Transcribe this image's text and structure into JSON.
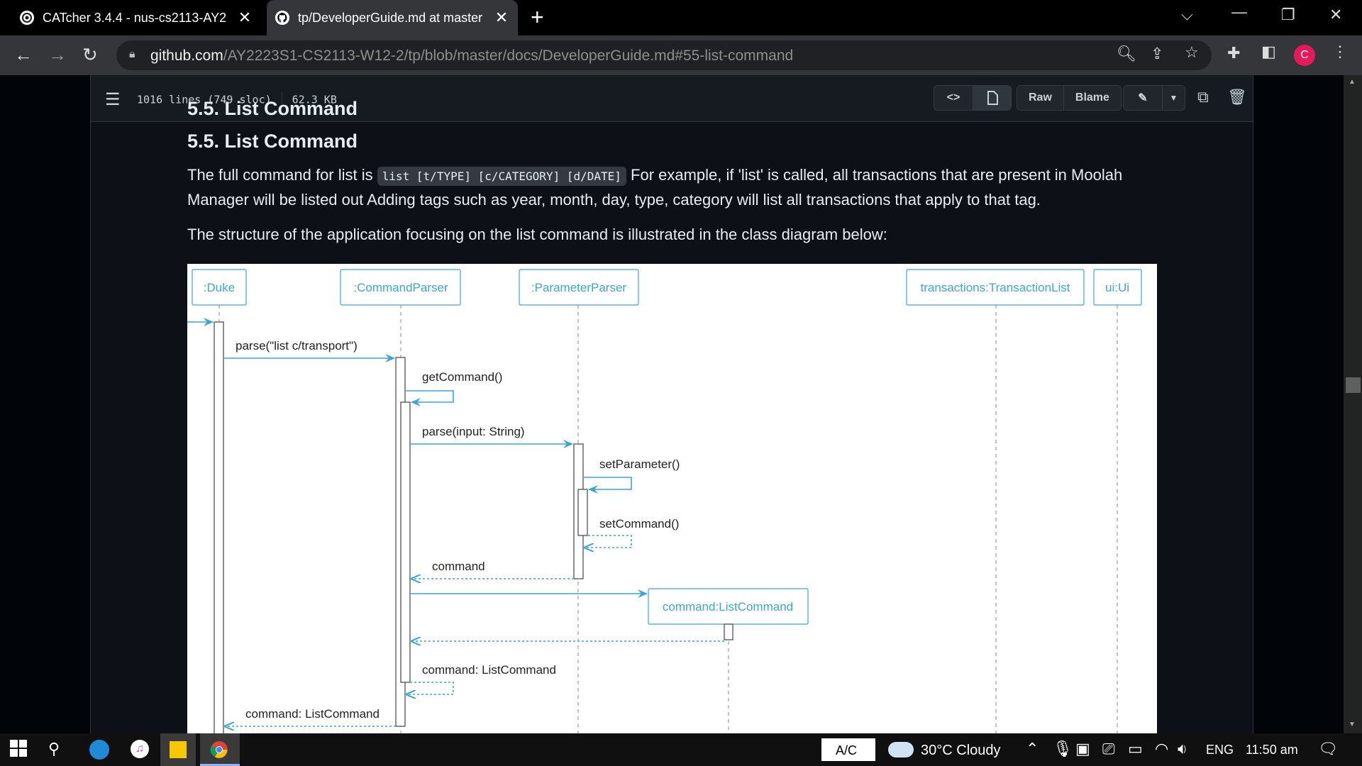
{
  "browser": {
    "tabs": [
      {
        "title": "CATcher 3.4.4 - nus-cs2113-AY22",
        "icon": "catcher-icon"
      },
      {
        "title": "tp/DeveloperGuide.md at master",
        "icon": "github-icon"
      }
    ],
    "url_host": "github.com",
    "url_path": "/AY2223S1-CS2113-W12-2/tp/blob/master/docs/DeveloperGuide.md#55-list-command",
    "profile_initial": "C"
  },
  "file_header": {
    "lines": "1016 lines (749 sloc)",
    "size": "62.3 KB",
    "raw_label": "Raw",
    "blame_label": "Blame"
  },
  "content": {
    "heading": "5.5. List Command",
    "p1_before": "The full command for list is ",
    "p1_code": "list [t/TYPE] [c/CATEGORY] [d/DATE]",
    "p1_after": " For example, if 'list' is called, all transactions that are present in Moolah Manager will be listed out Adding tags such as year, month, day, type, category will list all transactions that apply to that tag.",
    "p2": "The structure of the application focusing on the list command is illustrated in the class diagram below:"
  },
  "diagram": {
    "participants": [
      ":Duke",
      ":CommandParser",
      ":ParameterParser",
      "transactions:TransactionList",
      "ui:Ui"
    ],
    "created": "command:ListCommand",
    "messages": {
      "m1": "parse(\"list c/transport\")",
      "m2": "getCommand()",
      "m3": "parse(input: String)",
      "m4": "setParameter()",
      "m5": "setCommand()",
      "m6": "command",
      "m7": "command: ListCommand",
      "m8": "command: ListCommand"
    }
  },
  "taskbar": {
    "ac": "A/C",
    "weather": "30°C  Cloudy",
    "lang": "ENG",
    "time": "11:50 am"
  },
  "colors": {
    "accent_blue": "#3aa6d8",
    "page_bg": "#0d1117",
    "profile": "#e7195a"
  }
}
